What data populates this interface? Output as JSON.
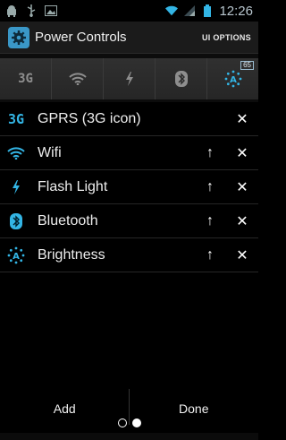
{
  "status_bar": {
    "time": "12:26",
    "icons": [
      "android-icon",
      "usb-icon",
      "image-icon",
      "wifi-icon",
      "signal-icon",
      "battery-icon"
    ]
  },
  "action_bar": {
    "title": "Power Controls",
    "options_label": "UI OPTIONS",
    "icon": "gear-icon"
  },
  "widget": {
    "buttons": [
      {
        "name": "3g",
        "label": "3G"
      },
      {
        "name": "wifi"
      },
      {
        "name": "flash"
      },
      {
        "name": "bluetooth"
      },
      {
        "name": "brightness"
      }
    ],
    "battery_level": "65"
  },
  "list": {
    "items": [
      {
        "label": "GPRS (3G icon)",
        "icon": "3g-icon",
        "icon_text": "3G",
        "move_up": false
      },
      {
        "label": "Wifi",
        "icon": "wifi-icon",
        "move_up": true
      },
      {
        "label": "Flash Light",
        "icon": "flash-icon",
        "move_up": true
      },
      {
        "label": "Bluetooth",
        "icon": "bluetooth-icon",
        "move_up": true
      },
      {
        "label": "Brightness",
        "icon": "brightness-icon",
        "move_up": true
      }
    ],
    "up_glyph": "↑",
    "remove_glyph": "✕"
  },
  "bottom": {
    "add_label": "Add",
    "done_label": "Done"
  },
  "pager": {
    "page_count": 2,
    "current": 2
  },
  "colors": {
    "accent": "#33b5e5",
    "widget_icon": "#8e8e8e"
  }
}
